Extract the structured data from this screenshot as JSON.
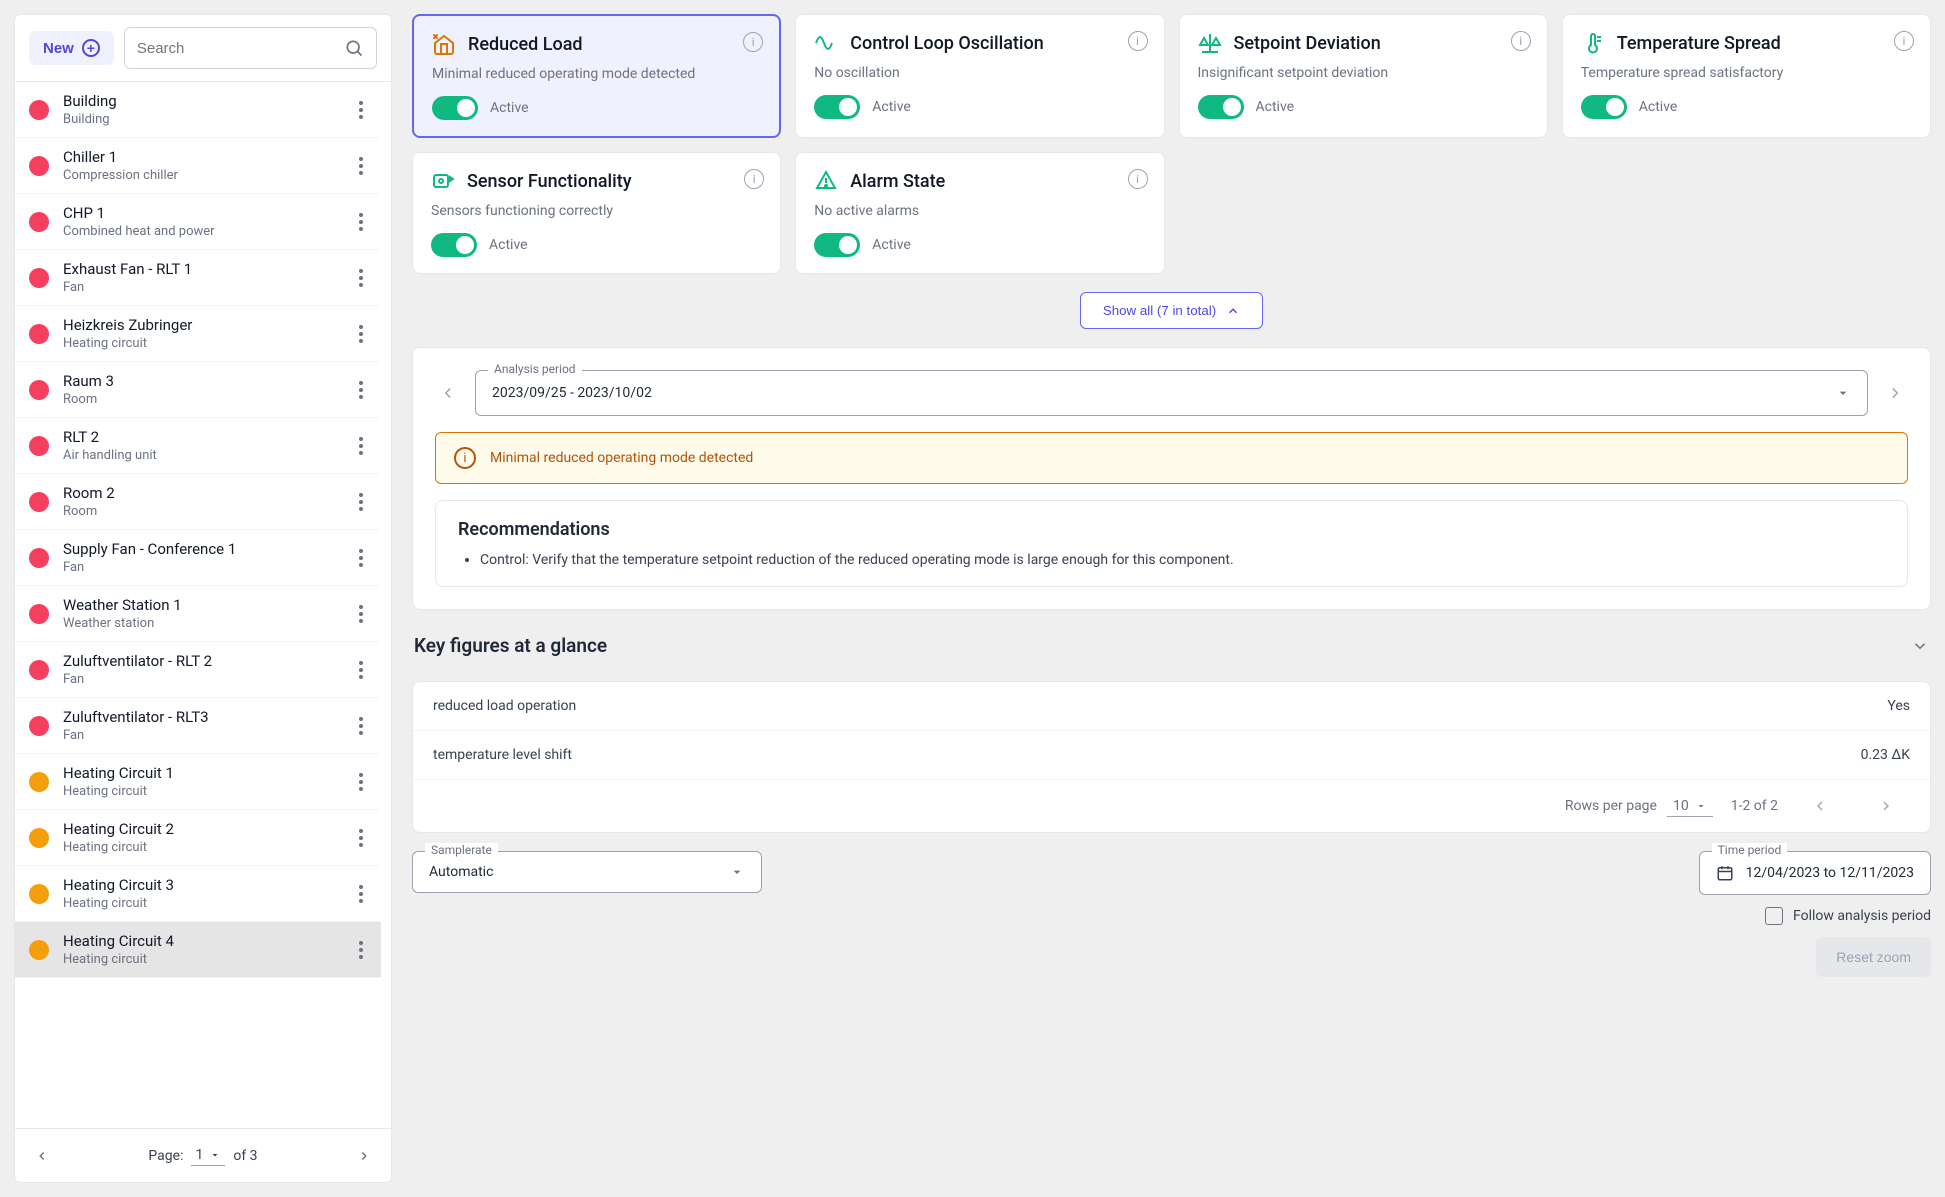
{
  "sidebar": {
    "new_label": "New",
    "search_placeholder": "Search",
    "items": [
      {
        "title": "Building",
        "sub": "Building",
        "color": "red"
      },
      {
        "title": "Chiller 1",
        "sub": "Compression chiller",
        "color": "red"
      },
      {
        "title": "CHP 1",
        "sub": "Combined heat and power",
        "color": "red"
      },
      {
        "title": "Exhaust Fan - RLT 1",
        "sub": "Fan",
        "color": "red"
      },
      {
        "title": "Heizkreis Zubringer",
        "sub": "Heating circuit",
        "color": "red"
      },
      {
        "title": "Raum 3",
        "sub": "Room",
        "color": "red"
      },
      {
        "title": "RLT 2",
        "sub": "Air handling unit",
        "color": "red"
      },
      {
        "title": "Room 2",
        "sub": "Room",
        "color": "red"
      },
      {
        "title": "Supply Fan - Conference 1",
        "sub": "Fan",
        "color": "red"
      },
      {
        "title": "Weather Station 1",
        "sub": "Weather station",
        "color": "red"
      },
      {
        "title": "Zuluftventilator - RLT 2",
        "sub": "Fan",
        "color": "red"
      },
      {
        "title": "Zuluftventilator - RLT3",
        "sub": "Fan",
        "color": "red"
      },
      {
        "title": "Heating Circuit 1",
        "sub": "Heating circuit",
        "color": "amber"
      },
      {
        "title": "Heating Circuit 2",
        "sub": "Heating circuit",
        "color": "amber"
      },
      {
        "title": "Heating Circuit 3",
        "sub": "Heating circuit",
        "color": "amber"
      },
      {
        "title": "Heating Circuit 4",
        "sub": "Heating circuit",
        "color": "amber",
        "selected": true
      }
    ],
    "pager": {
      "label": "Page:",
      "current": "1",
      "of": "of 3"
    }
  },
  "cards": [
    {
      "title": "Reduced Load",
      "sub": "Minimal reduced operating mode detected",
      "state": "Active",
      "color": "#d97706",
      "selected": true,
      "icon": "house"
    },
    {
      "title": "Control Loop Oscillation",
      "sub": "No oscillation",
      "state": "Active",
      "color": "#10b981",
      "icon": "wave"
    },
    {
      "title": "Setpoint Deviation",
      "sub": "Insignificant setpoint deviation",
      "state": "Active",
      "color": "#10b981",
      "icon": "scale"
    },
    {
      "title": "Temperature Spread",
      "sub": "Temperature spread satisfactory",
      "state": "Active",
      "color": "#10b981",
      "icon": "thermo"
    },
    {
      "title": "Sensor Functionality",
      "sub": "Sensors functioning correctly",
      "state": "Active",
      "color": "#10b981",
      "icon": "sensor"
    },
    {
      "title": "Alarm State",
      "sub": "No active alarms",
      "state": "Active",
      "color": "#10b981",
      "icon": "alarm"
    }
  ],
  "showall_label": "Show all (7 in total)",
  "period": {
    "legend": "Analysis period",
    "value": "2023/09/25 - 2023/10/02"
  },
  "alert": "Minimal reduced operating mode detected",
  "rec": {
    "title": "Recommendations",
    "items": [
      "Control: Verify that the temperature setpoint reduction of the reduced operating mode is large enough for this component."
    ]
  },
  "keyfigures": {
    "title": "Key figures at a glance",
    "rows": [
      {
        "k": "reduced load operation",
        "v": "Yes"
      },
      {
        "k": "temperature level shift",
        "v": "0.23 ΔK"
      }
    ],
    "pager": {
      "rpp_label": "Rows per page",
      "rpp": "10",
      "range": "1-2 of 2"
    }
  },
  "footer": {
    "samplerate_legend": "Samplerate",
    "samplerate_value": "Automatic",
    "timeperiod_legend": "Time period",
    "timeperiod_value": "12/04/2023 to 12/11/2023",
    "follow_label": "Follow analysis period",
    "reset_label": "Reset zoom"
  }
}
